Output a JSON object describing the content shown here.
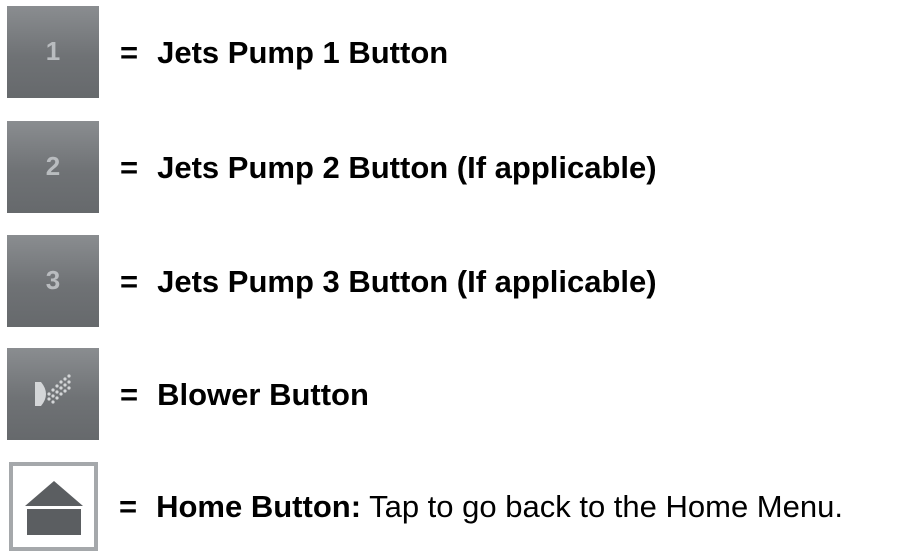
{
  "rows": [
    {
      "button_label": "1",
      "equals": "=",
      "description": "Jets Pump 1 Button"
    },
    {
      "button_label": "2",
      "equals": "=",
      "description": "Jets Pump 2 Button (If applicable)"
    },
    {
      "button_label": "3",
      "equals": "=",
      "description": "Jets Pump 3 Button (If applicable)"
    },
    {
      "icon": "blower-icon",
      "equals": "=",
      "description": "Blower Button"
    },
    {
      "icon": "home-icon",
      "equals": "=",
      "description": "Home Button:",
      "description_extra": "Tap to go back to the Home Menu."
    }
  ],
  "colors": {
    "tile_gray": "#6f7275",
    "tile_text": "#b9bcbf",
    "home_border": "#a5a8ab",
    "home_icon": "#5b5e61"
  }
}
